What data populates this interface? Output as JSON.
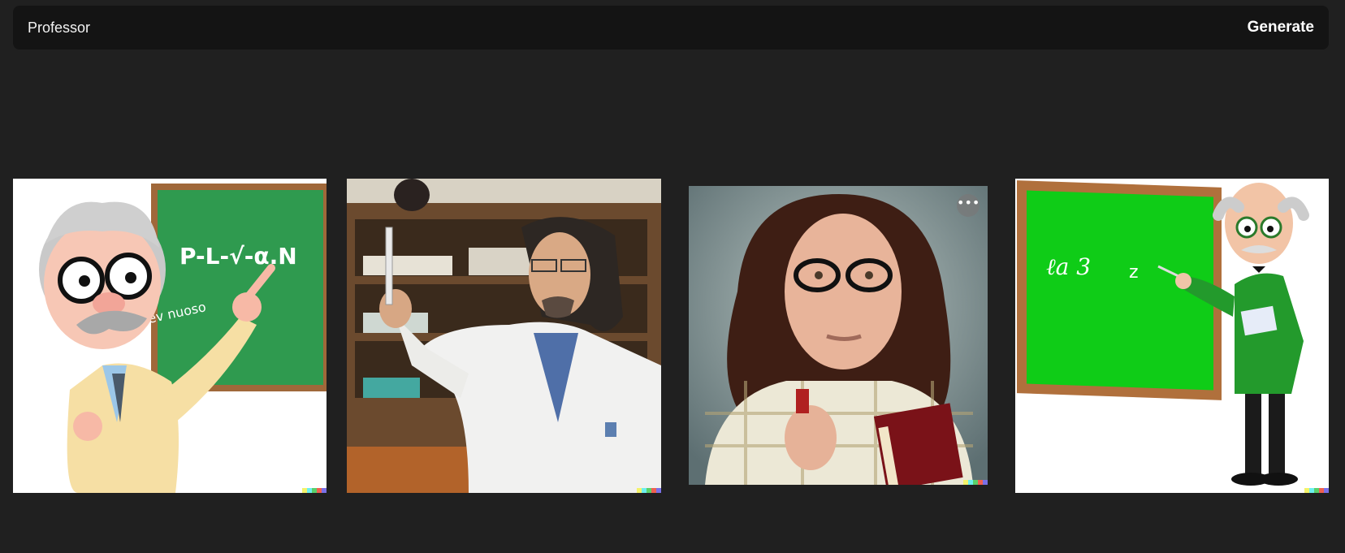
{
  "prompt": {
    "value": "Professor",
    "placeholder": "",
    "generate_label": "Generate"
  },
  "images": [
    {
      "subject": "cartoon-professor-chalkboard",
      "board_text_1": "P-L-√-α.N",
      "board_text_2": "Vev nuoso"
    },
    {
      "subject": "scientist-lab-coat"
    },
    {
      "subject": "professor-glasses-book",
      "more_label": "•••"
    },
    {
      "subject": "cartoon-professor-green-board",
      "board_text_1": "ℓa 3",
      "board_text_2": "z"
    }
  ],
  "colors": {
    "background": "#202020",
    "prompt_bar": "#141414",
    "text": "#f2f2f2",
    "signature": [
      "#f4f36a",
      "#6cf0ef",
      "#5ad06a",
      "#f06050",
      "#7a70e8"
    ]
  }
}
